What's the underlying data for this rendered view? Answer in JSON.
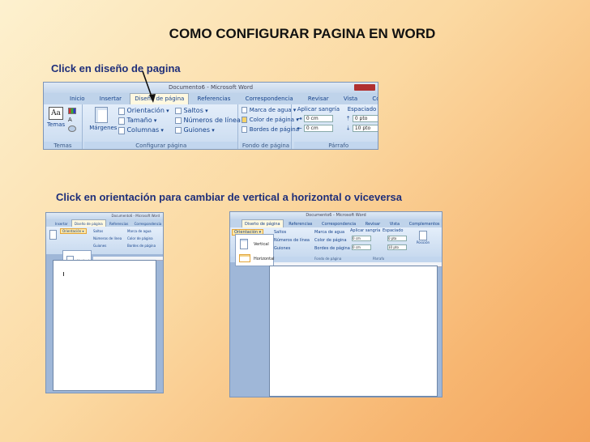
{
  "title": "COMO CONFIGURAR PAGINA EN WORD",
  "step1": "Click en diseño de pagina",
  "step2": "Click en orientación para cambiar de vertical a horizontal o viceversa",
  "shot1": {
    "window_title": "Documento6 - Microsoft Word",
    "tabs": [
      "Inicio",
      "Insertar",
      "Diseño de página",
      "Referencias",
      "Correspondencia",
      "Revisar",
      "Vista",
      "Complementos"
    ],
    "temas": {
      "cmd": "Temas",
      "label": "Temas"
    },
    "margenes": "Márgenes",
    "orientacion": "Orientación",
    "tamano": "Tamaño",
    "columnas": "Columnas",
    "saltos": "Saltos",
    "numeros_linea": "Números de línea",
    "guiones": "Guiones",
    "configurar_label": "Configurar página",
    "marca_agua": "Marca de agua",
    "color_pagina": "Color de página",
    "bordes_pagina": "Bordes de página",
    "fondo_label": "Fondo de página",
    "aplicar_sangria": "Aplicar sangría",
    "espaciado": "Espaciado",
    "sangria_izq": "0 cm",
    "sangria_der": "0 cm",
    "esp_antes": "0 pto",
    "esp_despues": "10 pto",
    "parrafo_label": "Párrafo"
  },
  "shot2": {
    "window_title": "Documento6 - Microsoft Word",
    "tabs": [
      "Insertar",
      "Diseño de página",
      "Referencias",
      "Correspondencia"
    ],
    "orientacion": "Orientación",
    "vertical": "Vertical",
    "horizontal": "Horizontal",
    "saltos": "Saltos",
    "numeros_linea": "Números de línea",
    "guiones": "Guiones",
    "marca_agua": "Marca de agua",
    "color_pagina": "Color de página",
    "bordes_pagina": "Bordes de página"
  },
  "shot3": {
    "window_title": "Documento6 - Microsoft Word",
    "tabs": [
      "Diseño de página",
      "Referencias",
      "Correspondencia",
      "Revisar",
      "Vista",
      "Complementos"
    ],
    "orientacion": "Orientación",
    "vertical": "Vertical",
    "horizontal": "Horizontal",
    "saltos": "Saltos",
    "numeros_linea": "Números de línea",
    "guiones": "Guiones",
    "marca_agua": "Marca de agua",
    "color_pagina": "Color de página",
    "bordes_pagina": "Bordes de página",
    "fondo_label": "Fondo de página",
    "aplicar_sangria": "Aplicar sangría",
    "espaciado": "Espaciado",
    "sangria_izq": "0 cm",
    "sangria_der": "0 cm",
    "esp_antes": "0 pto",
    "esp_despues": "10 pto",
    "parrafo_label": "Párrafo",
    "posicion": "Posición"
  }
}
